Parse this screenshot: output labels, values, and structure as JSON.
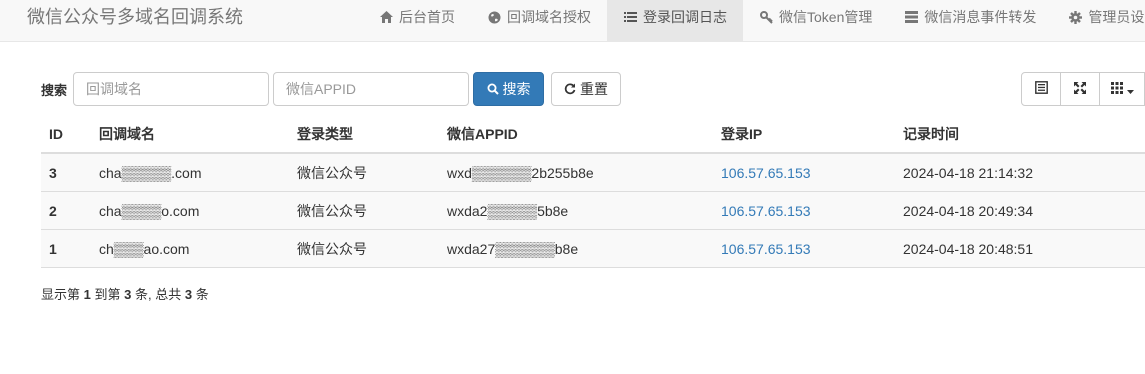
{
  "brand": "微信公众号多域名回调系统",
  "nav": [
    {
      "label": "后台首页",
      "icon": "home-icon",
      "active": false
    },
    {
      "label": "回调域名授权",
      "icon": "globe-icon",
      "active": false
    },
    {
      "label": "登录回调日志",
      "icon": "list-icon",
      "active": true
    },
    {
      "label": "微信Token管理",
      "icon": "key-icon",
      "active": false
    },
    {
      "label": "微信消息事件转发",
      "icon": "hdd-icon",
      "active": false
    },
    {
      "label": "管理员设置",
      "icon": "gear-icon",
      "active": false
    }
  ],
  "search": {
    "label": "搜索",
    "domain_placeholder": "回调域名",
    "appid_placeholder": "微信APPID",
    "search_button": "搜索",
    "reset_button": "重置"
  },
  "table": {
    "headers": [
      "ID",
      "回调域名",
      "登录类型",
      "微信APPID",
      "登录IP",
      "记录时间"
    ],
    "rows": [
      {
        "id": "3",
        "domain": "cha▒▒▒▒▒.com",
        "type": "微信公众号",
        "appid": "wxd▒▒▒▒▒▒2b255b8e",
        "ip": "106.57.65.153",
        "time": "2024-04-18 21:14:32"
      },
      {
        "id": "2",
        "domain": "cha▒▒▒▒o.com",
        "type": "微信公众号",
        "appid": "wxda2▒▒▒▒▒5b8e",
        "ip": "106.57.65.153",
        "time": "2024-04-18 20:49:34"
      },
      {
        "id": "1",
        "domain": "ch▒▒▒ao.com",
        "type": "微信公众号",
        "appid": "wxda27▒▒▒▒▒▒b8e",
        "ip": "106.57.65.153",
        "time": "2024-04-18 20:48:51"
      }
    ]
  },
  "pagination": {
    "prefix": "显示第",
    "from": "1",
    "to_label": "到第",
    "to": "3",
    "mid": "条, 总共",
    "total": "3",
    "suffix": "条"
  },
  "colors": {
    "primary": "#337ab7",
    "nav_bg": "#f8f8f8",
    "active_nav_bg": "#e7e7e7"
  }
}
